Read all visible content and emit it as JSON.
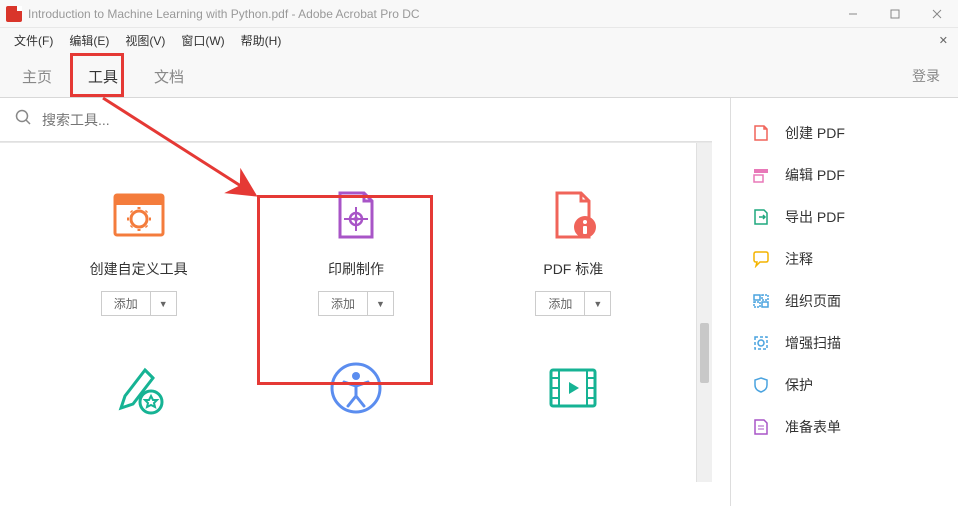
{
  "window": {
    "title": "Introduction to Machine Learning with Python.pdf - Adobe Acrobat Pro DC"
  },
  "menu": {
    "file": "文件(F)",
    "edit": "编辑(E)",
    "view": "视图(V)",
    "window": "窗口(W)",
    "help": "帮助(H)"
  },
  "tabs": {
    "home": "主页",
    "tools": "工具",
    "document": "文档",
    "login": "登录"
  },
  "search": {
    "placeholder": "搜索工具..."
  },
  "tools": [
    {
      "title": "创建自定义工具",
      "add": "添加"
    },
    {
      "title": "印刷制作",
      "add": "添加"
    },
    {
      "title": "PDF 标准",
      "add": "添加"
    }
  ],
  "sidebar": [
    {
      "label": "创建 PDF"
    },
    {
      "label": "编辑 PDF"
    },
    {
      "label": "导出 PDF"
    },
    {
      "label": "注释"
    },
    {
      "label": "组织页面"
    },
    {
      "label": "增强扫描"
    },
    {
      "label": "保护"
    },
    {
      "label": "准备表单"
    }
  ]
}
